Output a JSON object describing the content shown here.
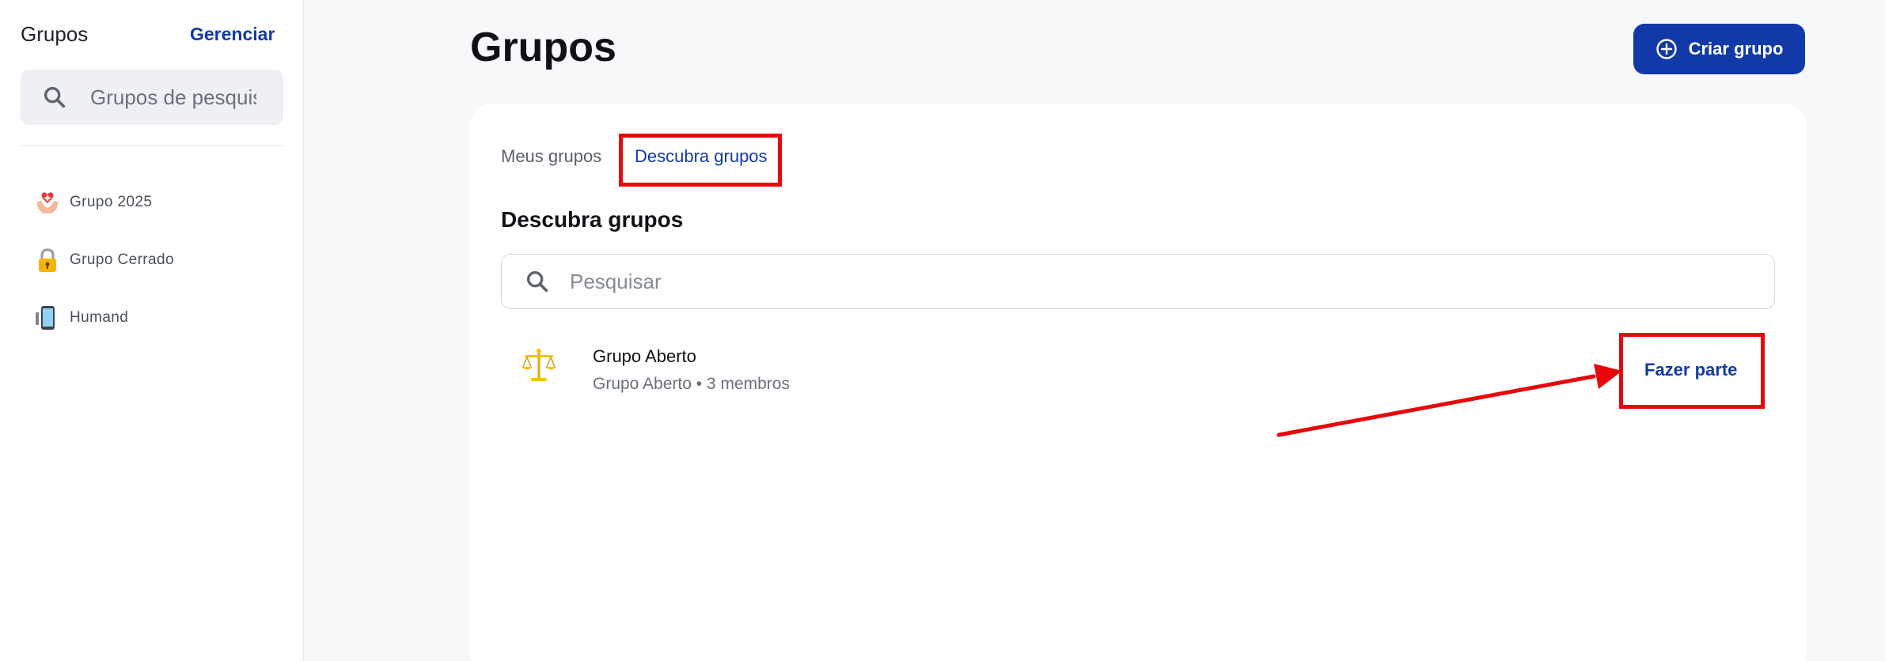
{
  "sidebar": {
    "title": "Grupos",
    "manage_label": "Gerenciar",
    "search_placeholder": "Grupos de pesquisa",
    "search_icon": "search-icon",
    "items": [
      {
        "label": "Grupo 2025",
        "icon": "heart-hands-icon"
      },
      {
        "label": "Grupo Cerrado",
        "icon": "lock-icon"
      },
      {
        "label": "Humand",
        "icon": "phone-icon"
      }
    ]
  },
  "header": {
    "title": "Grupos",
    "create_button_label": "Criar grupo",
    "create_button_icon": "plus-circle-icon"
  },
  "tabs": [
    {
      "label": "Meus grupos",
      "active": false
    },
    {
      "label": "Descubra grupos",
      "active": true
    }
  ],
  "section": {
    "title": "Descubra grupos",
    "search_placeholder": "Pesquisar"
  },
  "groups": [
    {
      "name": "Grupo Aberto",
      "meta": "Grupo Aberto • 3 membros",
      "icon": "scales-icon",
      "action_label": "Fazer parte"
    }
  ],
  "colors": {
    "accent": "#1239a8",
    "annotation": "#e8070a",
    "background": "#f7f8fa"
  }
}
